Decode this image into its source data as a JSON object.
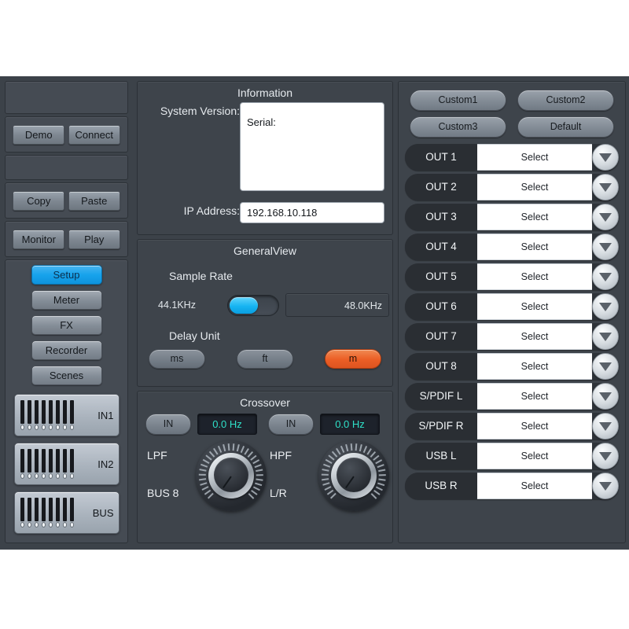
{
  "sidebar": {
    "top_buttons": [
      {
        "label": "Demo",
        "name": "demo-button"
      },
      {
        "label": "Connect",
        "name": "connect-button"
      }
    ],
    "edit_buttons": [
      {
        "label": "Copy",
        "name": "copy-button"
      },
      {
        "label": "Paste",
        "name": "paste-button"
      }
    ],
    "transport_buttons": [
      {
        "label": "Monitor",
        "name": "monitor-button"
      },
      {
        "label": "Play",
        "name": "play-button"
      }
    ],
    "nav_items": [
      {
        "label": "Setup",
        "active": true
      },
      {
        "label": "Meter",
        "active": false
      },
      {
        "label": "FX",
        "active": false
      },
      {
        "label": "Recorder",
        "active": false
      },
      {
        "label": "Scenes",
        "active": false
      }
    ],
    "meters": [
      {
        "label": "IN1",
        "channels": 8
      },
      {
        "label": "IN2",
        "channels": 8
      },
      {
        "label": "BUS",
        "channels": 8
      }
    ]
  },
  "information": {
    "title": "Information",
    "system_version_label": "System Version:",
    "system_version_value": "",
    "serial_label": "Serial:",
    "ip_label": "IP Address:",
    "ip_value": "192.168.10.118"
  },
  "general_view": {
    "title": "GeneralView",
    "sample_rate_label": "Sample Rate",
    "sample_rate_left": "44.1KHz",
    "sample_rate_right": "48.0KHz",
    "sample_rate_selected": "44.1KHz",
    "delay_unit_label": "Delay Unit",
    "delay_units": [
      {
        "label": "ms",
        "active": false
      },
      {
        "label": "ft",
        "active": false
      },
      {
        "label": "m",
        "active": true
      }
    ]
  },
  "crossover": {
    "title": "Crossover",
    "filters": [
      {
        "in_label": "IN",
        "freq_value": "0.0 Hz",
        "type_label": "LPF",
        "source_label": "BUS 8"
      },
      {
        "in_label": "IN",
        "freq_value": "0.0 Hz",
        "type_label": "HPF",
        "source_label": "L/R"
      }
    ]
  },
  "routing": {
    "presets": [
      {
        "label": "Custom1"
      },
      {
        "label": "Custom2"
      },
      {
        "label": "Custom3"
      },
      {
        "label": "Default"
      }
    ],
    "rows": [
      {
        "tag": "OUT 1",
        "value": "Select"
      },
      {
        "tag": "OUT 2",
        "value": "Select"
      },
      {
        "tag": "OUT 3",
        "value": "Select"
      },
      {
        "tag": "OUT 4",
        "value": "Select"
      },
      {
        "tag": "OUT 5",
        "value": "Select"
      },
      {
        "tag": "OUT 6",
        "value": "Select"
      },
      {
        "tag": "OUT 7",
        "value": "Select"
      },
      {
        "tag": "OUT 8",
        "value": "Select"
      },
      {
        "tag": "S/PDIF L",
        "value": "Select"
      },
      {
        "tag": "S/PDIF R",
        "value": "Select"
      },
      {
        "tag": "USB L",
        "value": "Select"
      },
      {
        "tag": "USB R",
        "value": "Select"
      }
    ]
  },
  "colors": {
    "accent_blue": "#17a3ec",
    "accent_orange": "#ec5f26",
    "lcd_teal": "#2fe0c8",
    "panel_bg": "#3e444b"
  }
}
